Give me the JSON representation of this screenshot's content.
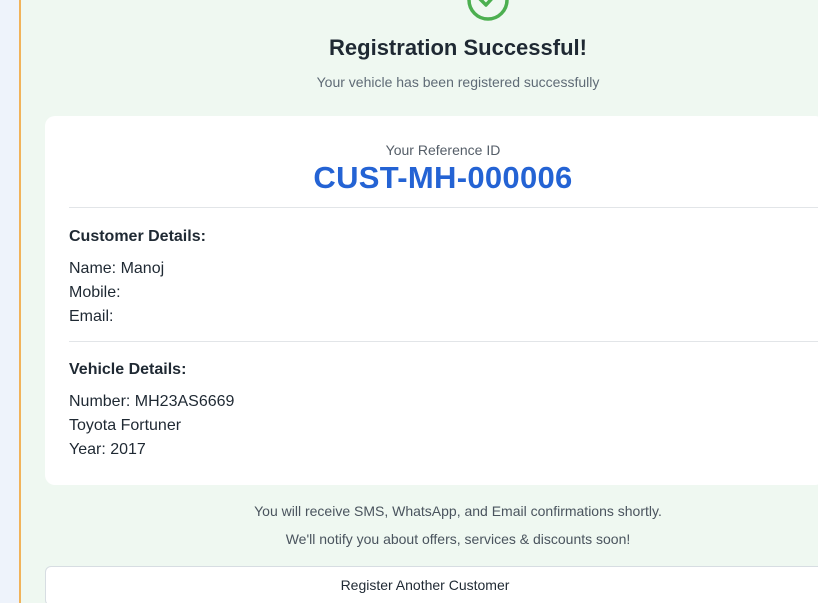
{
  "success": {
    "title": "Registration Successful!",
    "subtitle": "Your vehicle has been registered successfully",
    "icon": "check-circle-icon",
    "accent_color": "#4caf50"
  },
  "reference": {
    "label": "Your Reference ID",
    "id": "CUST-MH-000006",
    "color": "#2463d4"
  },
  "customer": {
    "heading": "Customer Details:",
    "name": "Name: Manoj",
    "mobile": "Mobile:",
    "email": "Email:"
  },
  "vehicle": {
    "heading": "Vehicle Details:",
    "number": "Number: MH23AS6669",
    "model": "Toyota Fortuner",
    "year": "Year: 2017"
  },
  "notes": {
    "confirmation": "You will receive SMS, WhatsApp, and Email confirmations shortly.",
    "offers": "We'll notify you about offers, services & discounts soon!"
  },
  "actions": {
    "register_another": "Register Another Customer"
  }
}
